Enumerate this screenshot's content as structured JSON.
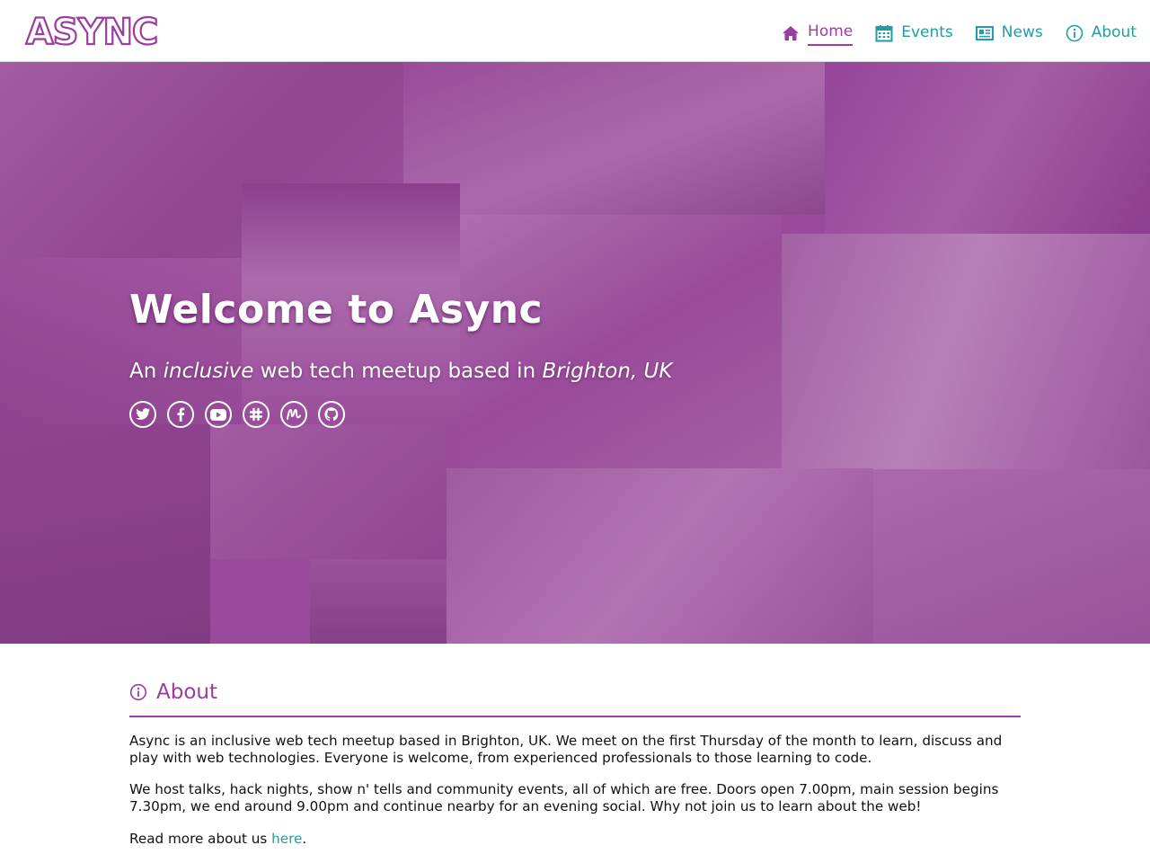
{
  "brand": {
    "name": "ASYNC",
    "logo_color": "#9b3c9e"
  },
  "nav": {
    "items": [
      {
        "label": "Home",
        "icon": "home-icon",
        "active": true
      },
      {
        "label": "Events",
        "icon": "calendar-icon",
        "active": false
      },
      {
        "label": "News",
        "icon": "newspaper-icon",
        "active": false
      },
      {
        "label": "About",
        "icon": "info-icon",
        "active": false
      }
    ]
  },
  "hero": {
    "title": "Welcome to Async",
    "subtitle": {
      "part1": "An ",
      "em1": "inclusive",
      "part2": " web tech meetup based in ",
      "em2": "Brighton, UK"
    },
    "social": [
      {
        "name": "twitter",
        "icon": "twitter-icon"
      },
      {
        "name": "facebook",
        "icon": "facebook-icon"
      },
      {
        "name": "youtube",
        "icon": "youtube-icon"
      },
      {
        "name": "slack",
        "icon": "slack-icon"
      },
      {
        "name": "meetup",
        "icon": "meetup-icon"
      },
      {
        "name": "github",
        "icon": "github-icon"
      }
    ]
  },
  "about": {
    "title": "About",
    "p1": "Async is an inclusive web tech meetup based in Brighton, UK. We meet on the first Thursday of the month to learn, discuss and play with web technologies. Everyone is welcome, from experienced professionals to those learning to code.",
    "p2": "We host talks, hack nights, show n' tells and community events, all of which are free. Doors open 7.00pm, main session begins 7.30pm, we end around 9.00pm and continue nearby for an evening social. Why not join us to learn about the web!",
    "p3_before": "Read more about us ",
    "p3_link": "here",
    "p3_after": "."
  },
  "colors": {
    "accent_purple": "#9b3c9e",
    "accent_teal": "#1e9ea6",
    "hero_overlay": "#9a4d9c"
  }
}
